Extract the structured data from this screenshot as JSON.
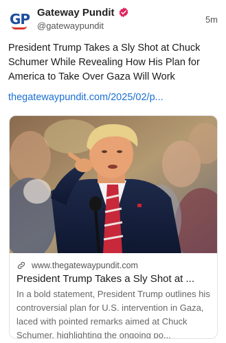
{
  "account": {
    "name": "Gateway Pundit",
    "handle": "@gatewaypundit",
    "time": "5m",
    "logo_text_g": "G",
    "logo_text_p": "P"
  },
  "post": {
    "text": "President Trump Takes a Sly Shot at Chuck Schumer While Revealing How His Plan for America to Take Over Gaza Will Work",
    "link": "thegatewaypundit.com/2025/02/p..."
  },
  "card": {
    "domain": "www.thegatewaypundit.com",
    "title": "President Trump Takes a Sly Shot at ...",
    "description": "In a bold statement, President Trump outlines his controversial plan for U.S. intervention in Gaza, laced with pointed remarks aimed at Chuck Schumer, highlighting the ongoing po..."
  },
  "colors": {
    "link": "#1a6fd1",
    "verified": "#e0245e",
    "brand_blue": "#1d4f9e",
    "brand_red": "#d9342b"
  },
  "icons": {
    "verified": "verified-badge-icon",
    "link": "link-icon"
  }
}
